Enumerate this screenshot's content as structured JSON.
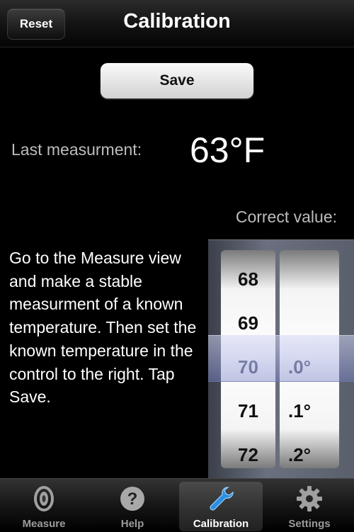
{
  "navbar": {
    "title": "Calibration",
    "reset_label": "Reset"
  },
  "save_label": "Save",
  "last": {
    "label": "Last measurment:",
    "value": "63°F"
  },
  "correct_label": "Correct value:",
  "instructions": "Go to the Measure view and make a stable measurment of a known temperature. Then set the known temperature in the control to the right. Tap Save.",
  "picker": {
    "wheel1": [
      "68",
      "69",
      "70",
      "71",
      "72"
    ],
    "wheel2": [
      "",
      "",
      ".0°",
      ".1°",
      ".2°"
    ],
    "selected_whole": "70",
    "selected_fraction": ".0°"
  },
  "tabs": [
    {
      "label": "Measure",
      "icon": "speaker-icon"
    },
    {
      "label": "Help",
      "icon": "question-icon"
    },
    {
      "label": "Calibration",
      "icon": "wrench-icon",
      "active": true
    },
    {
      "label": "Settings",
      "icon": "gear-icon"
    }
  ],
  "colors": {
    "accent_blue": "#2a8fe0",
    "selection_tint": "#b7bde8"
  }
}
